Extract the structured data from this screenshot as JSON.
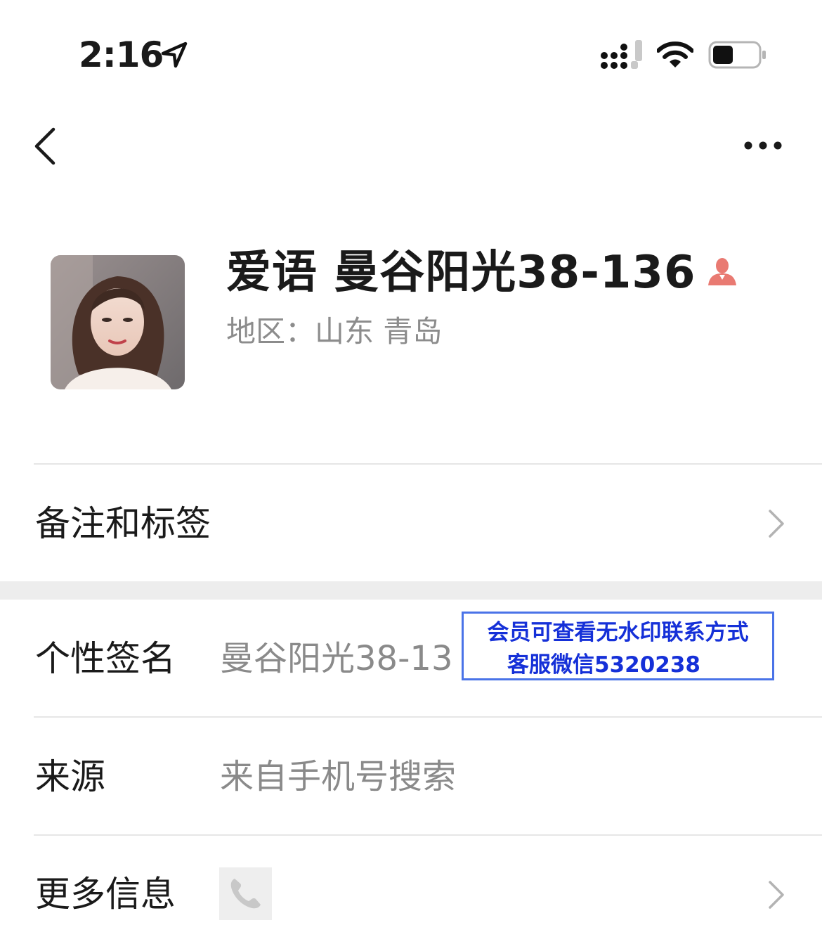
{
  "status_bar": {
    "time": "2:16"
  },
  "profile": {
    "name": "爱语  曼谷阳光38-136",
    "region": "地区：山东 青岛"
  },
  "rows": {
    "remark": {
      "label": "备注和标签"
    },
    "signature": {
      "label": "个性签名",
      "value": "曼谷阳光38-13"
    },
    "source": {
      "label": "来源",
      "value": "来自手机号搜索"
    },
    "more_info": {
      "label": "更多信息"
    }
  },
  "watermark": {
    "line1": "会员可查看无水印联系方式",
    "line2": "客服微信5320238"
  },
  "colors": {
    "accent_service": "#e97a72",
    "watermark_text": "#1530d8",
    "watermark_border": "#4a73e8",
    "secondary_text": "#8a8a8a",
    "divider": "#e6e6e6"
  },
  "icons": [
    "location-arrow-icon",
    "signal-icon",
    "wifi-icon",
    "battery-icon",
    "back-icon",
    "more-icon",
    "customer-service-icon",
    "chevron-right-icon",
    "phone-icon"
  ]
}
